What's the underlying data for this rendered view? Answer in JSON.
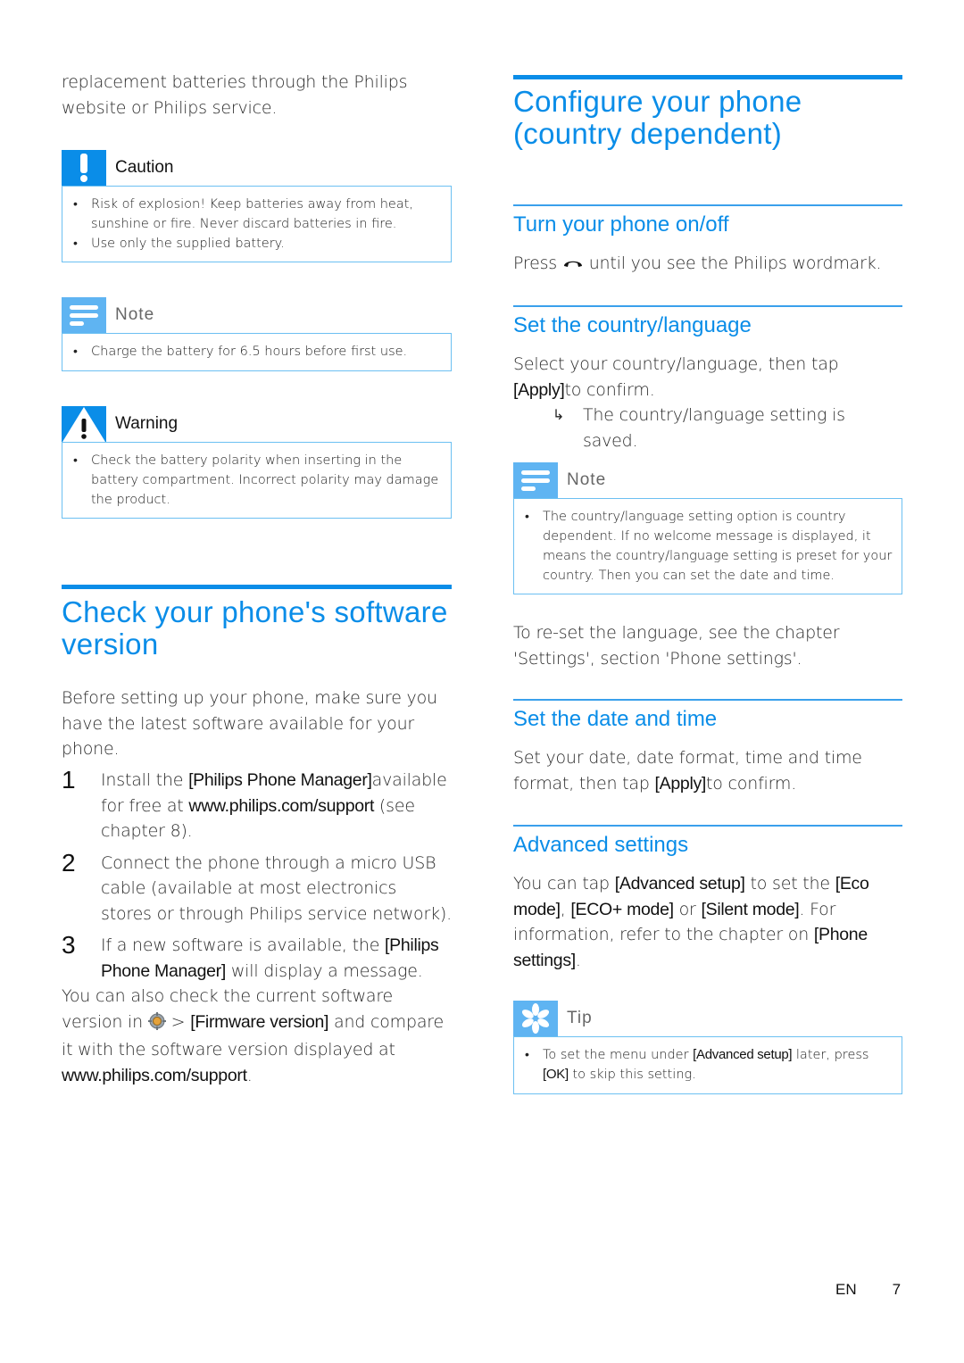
{
  "left": {
    "intro": "replacement batteries through the Philips website or Philips service.",
    "caution": {
      "title": "Caution",
      "icon": "exclamation-icon",
      "items": [
        "Risk of explosion! Keep batteries away from heat, sunshine or fire. Never discard batteries in fire.",
        "Use only the supplied battery."
      ]
    },
    "note": {
      "title": "Note",
      "icon": "note-lines-icon",
      "items": [
        "Charge the battery for 6.5 hours before first use."
      ]
    },
    "warning": {
      "title": "Warning",
      "icon": "warning-triangle-icon",
      "items": [
        "Check the battery polarity when inserting in the battery compartment. Incorrect polarity may damage the product."
      ]
    },
    "section": {
      "heading": "Check your phone's software version",
      "intro": "Before setting up your phone, make sure you have the latest software available for your phone.",
      "steps": [
        {
          "num": "1",
          "parts": [
            "Install the ",
            "[Philips Phone Manager]",
            "available for free at ",
            "www.philips.com/support",
            " (see chapter 8)."
          ]
        },
        {
          "num": "2",
          "text": "Connect the phone through a micro USB cable (available at most electronics stores or through Philips service network)."
        },
        {
          "num": "3",
          "parts": [
            "If a new software is available, the ",
            "[Philips Phone Manager]",
            " will display a message."
          ]
        }
      ],
      "outro": {
        "p1": "You can also check the current software version in ",
        "icon": "settings-gear-icon",
        "p2": " > ",
        "b1": "[Firmware version]",
        "p3": " and compare it with the software version displayed at ",
        "b2": "www.philips.com/support",
        "p4": "."
      }
    }
  },
  "right": {
    "heading": "Configure your phone (country dependent)",
    "turn_on": {
      "heading": "Turn your phone on/off",
      "p1": "Press ",
      "icon": "end-call-icon",
      "p2": " until you see the Philips wordmark."
    },
    "country": {
      "heading": "Set the country/language",
      "p1": "Select your country/language, then tap ",
      "b1": "[Apply]",
      "p2": "to confirm.",
      "result": "The country/language setting is saved.",
      "note": {
        "title": "Note",
        "items": [
          "The country/language setting option is country dependent. If no welcome message is displayed, it means the country/language setting is preset for your country. Then you can set the date and time."
        ]
      },
      "reset": "To re-set the language, see the chapter 'Settings', section 'Phone settings'."
    },
    "datetime": {
      "heading": "Set the date and time",
      "p1": "Set your date, date format, time and time format, then tap ",
      "b1": "[Apply]",
      "p2": "to confirm."
    },
    "advanced": {
      "heading": "Advanced settings",
      "p1": "You can tap ",
      "b1": "[Advanced setup]",
      "p2": " to set the ",
      "b2": "[Eco mode]",
      "p3": ", ",
      "b3": "[ECO+ mode]",
      "p4": " or ",
      "b4": "[Silent mode]",
      "p5": ". For information, refer to the chapter on ",
      "b5": "[Phone settings]",
      "p6": ".",
      "tip": {
        "title": "Tip",
        "icon": "tip-asterisk-icon",
        "p1": "To set the menu under ",
        "b1": "[Advanced setup]",
        "p2": " later, press ",
        "b2": "[OK]",
        "p3": " to skip this setting."
      }
    }
  },
  "footer": {
    "lang": "EN",
    "page": "7"
  },
  "colors": {
    "accent": "#0a8de8",
    "note_icon_bg": "#5fb4f2",
    "box_border": "#6cc0f2"
  }
}
